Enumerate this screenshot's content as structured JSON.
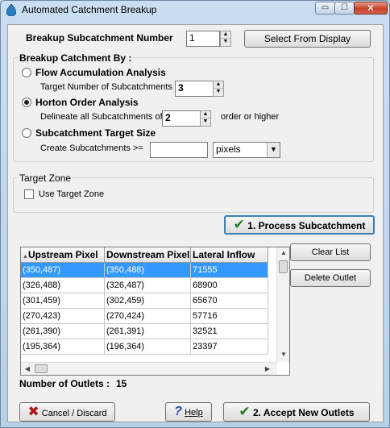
{
  "window": {
    "title": "Automated Catchment Breakup",
    "min_glyph": "▭",
    "max_glyph": "☐",
    "close_glyph": "✕"
  },
  "subcatchment": {
    "label": "Breakup Subcatchment Number",
    "value": "1",
    "select_button": "Select From Display"
  },
  "breakup_group": {
    "title": "Breakup Catchment By :",
    "flow": {
      "label": "Flow Accumulation Analysis",
      "checked": false,
      "target_label": "Target Number of Subcatchments",
      "target_value": "3"
    },
    "horton": {
      "label": "Horton Order Analysis",
      "checked": true,
      "delineate_label": "Delineate all Subcatchments of",
      "order_value": "2",
      "order_suffix": "order or higher"
    },
    "target_size": {
      "label": "Subcatchment Target Size",
      "checked": false,
      "create_label": "Create Subcatchments >=",
      "value": "",
      "unit": "pixels"
    }
  },
  "target_zone": {
    "title": "Target Zone",
    "checkbox_label": "Use Target Zone",
    "checked": false
  },
  "process_button": "1. Process Subcatchment",
  "grid": {
    "sort_glyph": "▲",
    "columns": [
      "Upstream Pixel",
      "Downstream Pixel",
      "Lateral Inflow"
    ],
    "rows": [
      [
        "(350,487)",
        "(350,488)",
        "71555"
      ],
      [
        "(326,488)",
        "(326,487)",
        "68900"
      ],
      [
        "(301,459)",
        "(302,459)",
        "65670"
      ],
      [
        "(270,423)",
        "(270,424)",
        "57716"
      ],
      [
        "(261,390)",
        "(261,391)",
        "32521"
      ],
      [
        "(195,364)",
        "(196,364)",
        "23397"
      ]
    ],
    "selected_row": 0
  },
  "clear_list_button": "Clear List",
  "delete_outlet_button": "Delete Outlet",
  "outlets": {
    "label": "Number of Outlets :",
    "count": "15"
  },
  "footer": {
    "cancel": "Cancel / Discard",
    "help": "Help",
    "accept": "2. Accept New Outlets"
  },
  "icons": {
    "check": "✔",
    "cross": "✖",
    "help": "?",
    "up": "▲",
    "down": "▼",
    "left": "◀",
    "right": "▶"
  },
  "colors": {
    "selection": "#3399ff",
    "check_green": "#1e7d1e",
    "cancel_red": "#b01818"
  }
}
